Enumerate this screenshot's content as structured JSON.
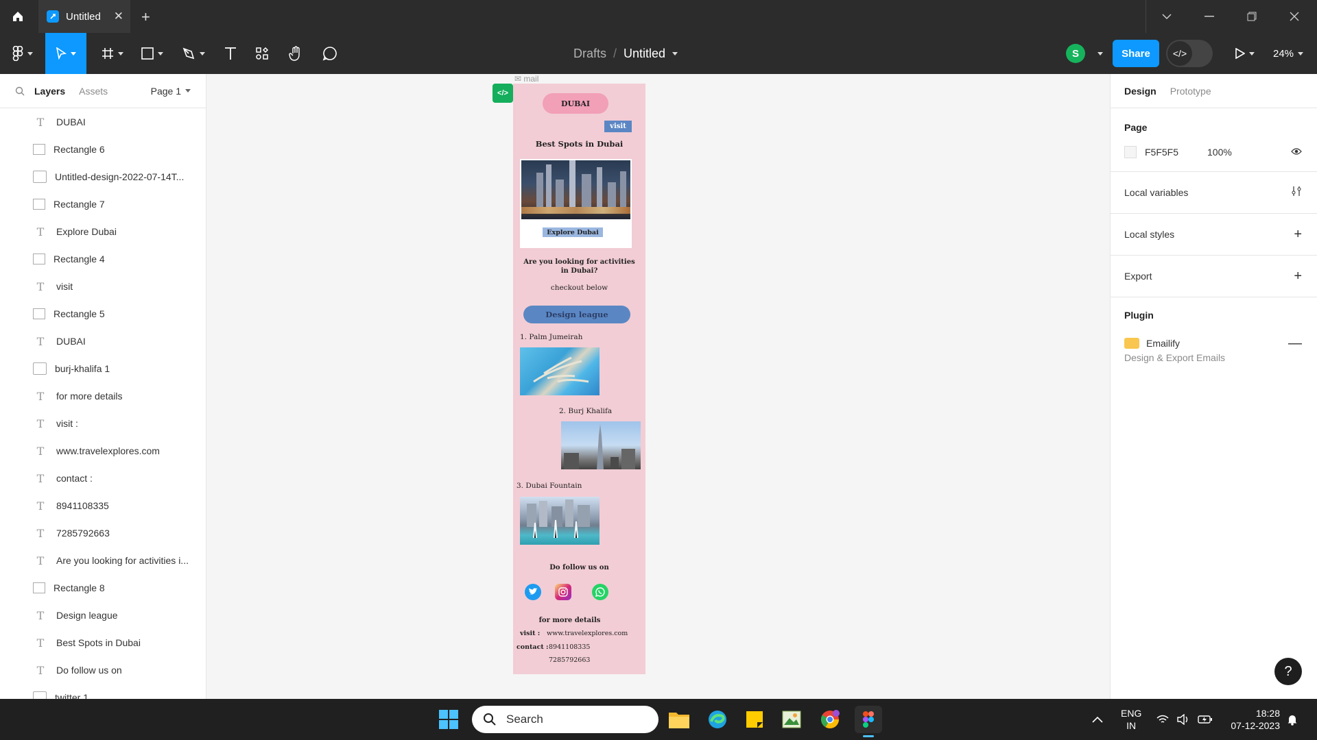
{
  "titlebar": {
    "tab_title": "Untitled",
    "icons": [
      "home-icon",
      "figma-file-icon",
      "close-icon",
      "plus-icon",
      "chevron-down-icon",
      "minimize-icon",
      "restore-icon",
      "window-close-icon"
    ]
  },
  "toolbar": {
    "breadcrumb_parent": "Drafts",
    "breadcrumb_separator": "/",
    "file_name": "Untitled",
    "avatar_initial": "S",
    "share_label": "Share",
    "zoom": "24%",
    "accent_color": "#0d99ff",
    "tools": [
      "main-menu",
      "move",
      "frame",
      "shape",
      "pen",
      "text",
      "resources",
      "hand",
      "comment"
    ]
  },
  "left_panel": {
    "tabs": [
      "Layers",
      "Assets"
    ],
    "page_selector": "Page 1",
    "layers": [
      {
        "name": "DUBAI",
        "type": "text"
      },
      {
        "name": "Rectangle 6",
        "type": "rect"
      },
      {
        "name": "Untitled-design-2022-07-14T...",
        "type": "image"
      },
      {
        "name": "Rectangle 7",
        "type": "rect"
      },
      {
        "name": "Explore Dubai",
        "type": "text"
      },
      {
        "name": "Rectangle 4",
        "type": "rect"
      },
      {
        "name": "visit",
        "type": "text"
      },
      {
        "name": "Rectangle 5",
        "type": "rect"
      },
      {
        "name": "DUBAI",
        "type": "text"
      },
      {
        "name": "burj-khalifa 1",
        "type": "image"
      },
      {
        "name": "for more details",
        "type": "text"
      },
      {
        "name": "visit :",
        "type": "text"
      },
      {
        "name": "www.travelexplores.com",
        "type": "text"
      },
      {
        "name": "contact :",
        "type": "text"
      },
      {
        "name": "8941108335",
        "type": "text"
      },
      {
        "name": "7285792663",
        "type": "text"
      },
      {
        "name": "Are you looking for activities i...",
        "type": "text"
      },
      {
        "name": "Rectangle 8",
        "type": "rect"
      },
      {
        "name": "Design league",
        "type": "text"
      },
      {
        "name": "Best Spots in Dubai",
        "type": "text"
      },
      {
        "name": "Do follow us on",
        "type": "text"
      },
      {
        "name": "twitter 1",
        "type": "image"
      }
    ]
  },
  "canvas": {
    "frame_label": "mail",
    "email": {
      "pill": "DUBAI",
      "visit": "visit",
      "heading": "Best Spots in Dubai",
      "explore": "Explore  Dubai",
      "question": "Are you looking for activities in  Dubai?",
      "checkout": "checkout below",
      "button": "Design league",
      "spots": [
        "1. Palm Jumeirah",
        "2. Burj Khalifa",
        "3. Dubai Fountain"
      ],
      "follow": "Do follow us on",
      "more_details": "for more details",
      "visit_label": "visit :",
      "website": "www.travelexplores.com",
      "contact_label": "contact :",
      "phone1": "8941108335",
      "phone2": "7285792663",
      "bg_color": "#f2cdd5"
    }
  },
  "right_panel": {
    "tabs": [
      "Design",
      "Prototype"
    ],
    "page_section": "Page",
    "page_color": "F5F5F5",
    "page_opacity": "100%",
    "local_variables": "Local variables",
    "local_styles": "Local styles",
    "export": "Export",
    "plugin_section": "Plugin",
    "plugin_name": "Emailify",
    "plugin_desc": "Design & Export Emails"
  },
  "taskbar": {
    "search_placeholder": "Search",
    "lang_line1": "ENG",
    "lang_line2": "IN",
    "time": "18:28",
    "date": "07-12-2023"
  }
}
